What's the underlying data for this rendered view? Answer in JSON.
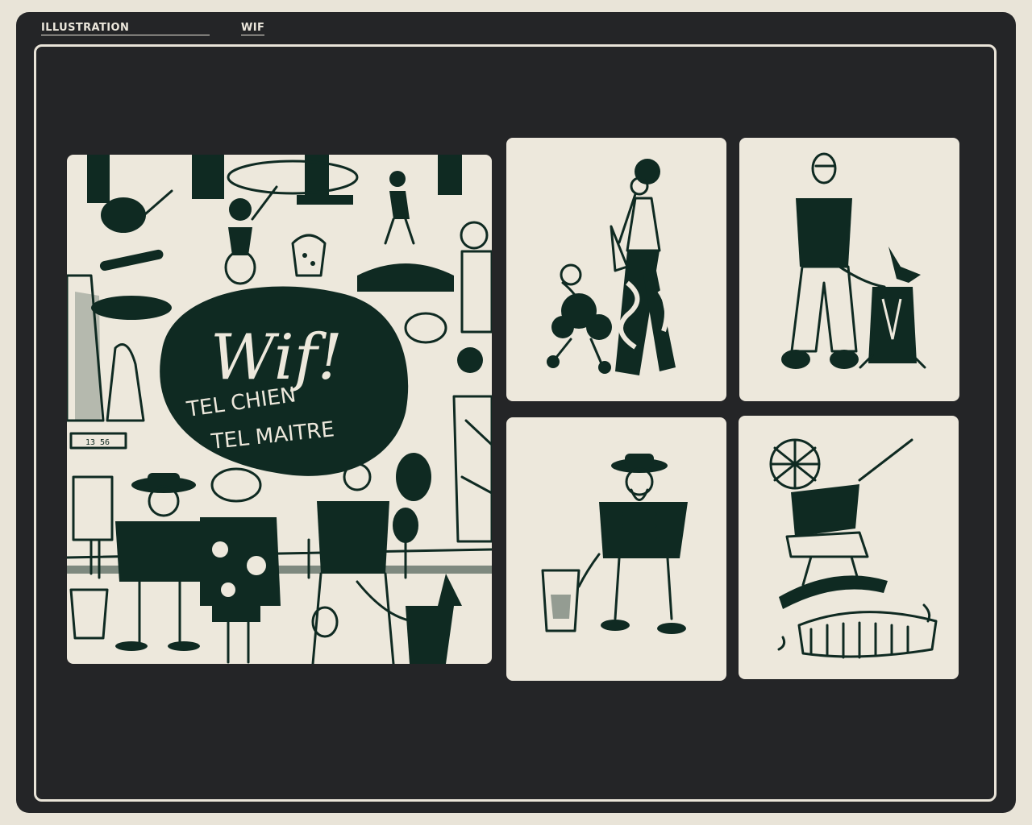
{
  "header": {
    "section_label": "ILLUSTRATION",
    "project_label": "WIF"
  },
  "cover": {
    "title": "Wif!",
    "subtitle_line1": "TEL CHIEN",
    "subtitle_line2": "TEL MAITRE",
    "sign_text": "13 56"
  },
  "gallery": {
    "items": [
      {
        "id": "poodle-woman",
        "icon": "poodle-and-woman-illustration"
      },
      {
        "id": "doberman-man",
        "icon": "doberman-and-bald-man-illustration"
      },
      {
        "id": "yorkie-old-man",
        "icon": "yorkshire-and-old-man-illustration"
      },
      {
        "id": "skater-komondor",
        "icon": "skater-and-mop-dog-illustration"
      }
    ]
  },
  "colors": {
    "frame": "#242527",
    "paper": "#ede8dc",
    "ink": "#0f2a22",
    "page_bg": "#e9e4d8"
  }
}
